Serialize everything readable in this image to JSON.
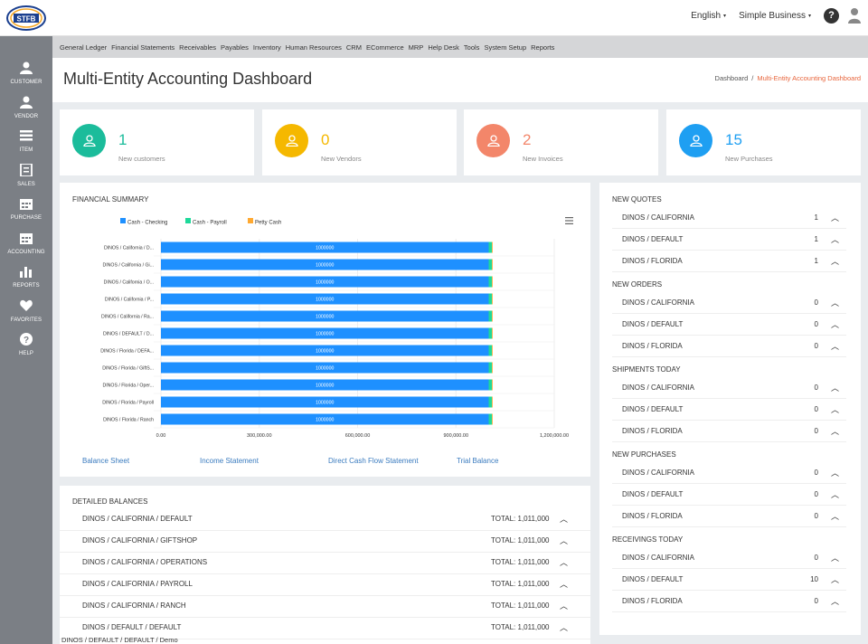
{
  "header": {
    "language": "English",
    "company": "Simple Business"
  },
  "sidebar": [
    {
      "label": "CUSTOMER",
      "icon": "person-icon"
    },
    {
      "label": "VENDOR",
      "icon": "person-icon"
    },
    {
      "label": "ITEM",
      "icon": "list-icon"
    },
    {
      "label": "SALES",
      "icon": "document-icon"
    },
    {
      "label": "PURCHASE",
      "icon": "calendar-icon"
    },
    {
      "label": "ACCOUNTING",
      "icon": "calendar-icon"
    },
    {
      "label": "REPORTS",
      "icon": "bar-chart-icon"
    },
    {
      "label": "FAVORITES",
      "icon": "heart-icon"
    },
    {
      "label": "HELP",
      "icon": "question-icon"
    }
  ],
  "menu": [
    "General Ledger",
    "Financial Statements",
    "Receivables",
    "Payables",
    "Inventory",
    "Human Resources",
    "CRM",
    "ECommerce",
    "MRP",
    "Help Desk",
    "Tools",
    "System Setup",
    "Reports"
  ],
  "page": {
    "title": "Multi-Entity Accounting Dashboard",
    "breadcrumb_home": "Dashboard",
    "breadcrumb_sep": "/",
    "breadcrumb_current": "Multi-Entity Accounting Dashboard"
  },
  "stats": [
    {
      "value": "1",
      "label": "New customers",
      "color": "#1bbc9b"
    },
    {
      "value": "0",
      "label": "New Vendors",
      "color": "#f5b800"
    },
    {
      "value": "2",
      "label": "New Invoices",
      "color": "#f3866a"
    },
    {
      "value": "15",
      "label": "New Purchases",
      "color": "#1e9ff2"
    }
  ],
  "financial_summary": {
    "title": "FINANCIAL SUMMARY",
    "links": [
      "Balance Sheet",
      "Income Statement",
      "Direct Cash Flow Statement",
      "Trial Balance"
    ]
  },
  "chart_data": {
    "type": "bar",
    "orientation": "horizontal",
    "stacked": true,
    "categories": [
      "DINOS / California / D...",
      "DINOS / California / Gi...",
      "DINOS / California / O...",
      "DINOS / California / P...",
      "DINOS / California / Ra...",
      "DINOS / DEFAULT / D...",
      "DINOS / Florida / DEFA...",
      "DINOS / Florida / GiftS...",
      "DINOS / Florida / Oper...",
      "DINOS / Florida / Payroll",
      "DINOS / Florida / Ranch"
    ],
    "series": [
      {
        "name": "Cash - Checking",
        "color": "#1e90ff",
        "values": [
          1000000,
          1000000,
          1000000,
          1000000,
          1000000,
          1000000,
          1000000,
          1000000,
          1000000,
          1000000,
          1000000
        ]
      },
      {
        "name": "Cash - Payroll",
        "color": "#1ed99a",
        "values": [
          10000,
          10000,
          10000,
          10000,
          10000,
          10000,
          10000,
          10000,
          10000,
          10000,
          10000
        ]
      },
      {
        "name": "Petty Cash",
        "color": "#ffa931",
        "values": [
          1000,
          1000,
          1000,
          1000,
          1000,
          1000,
          1000,
          1000,
          1000,
          1000,
          1000
        ]
      }
    ],
    "data_label": "1000000",
    "xlim": [
      0,
      1200000
    ],
    "xticks": [
      "0.00",
      "300,000.00",
      "600,000.00",
      "900,000.00",
      "1,200,000.00"
    ],
    "legend": "top"
  },
  "detailed_balances": {
    "title": "DETAILED BALANCES",
    "rows": [
      {
        "name": "DINOS / CALIFORNIA / DEFAULT",
        "total": "TOTAL: 1,011,000"
      },
      {
        "name": "DINOS / CALIFORNIA / GIFTSHOP",
        "total": "TOTAL: 1,011,000"
      },
      {
        "name": "DINOS / CALIFORNIA / OPERATIONS",
        "total": "TOTAL: 1,011,000"
      },
      {
        "name": "DINOS / CALIFORNIA / PAYROLL",
        "total": "TOTAL: 1,011,000"
      },
      {
        "name": "DINOS / CALIFORNIA / RANCH",
        "total": "TOTAL: 1,011,000"
      },
      {
        "name": "DINOS / DEFAULT / DEFAULT",
        "total": "TOTAL: 1,011,000"
      }
    ],
    "tail": "DINOS / DEFAULT / DEFAULT / Demo"
  },
  "right_panel": [
    {
      "title": "NEW QUOTES",
      "rows": [
        [
          "DINOS / CALIFORNIA",
          "1"
        ],
        [
          "DINOS / DEFAULT",
          "1"
        ],
        [
          "DINOS / FLORIDA",
          "1"
        ]
      ]
    },
    {
      "title": "NEW ORDERS",
      "rows": [
        [
          "DINOS / CALIFORNIA",
          "0"
        ],
        [
          "DINOS / DEFAULT",
          "0"
        ],
        [
          "DINOS / FLORIDA",
          "0"
        ]
      ]
    },
    {
      "title": "SHIPMENTS TODAY",
      "rows": [
        [
          "DINOS / CALIFORNIA",
          "0"
        ],
        [
          "DINOS / DEFAULT",
          "0"
        ],
        [
          "DINOS / FLORIDA",
          "0"
        ]
      ]
    },
    {
      "title": "NEW PURCHASES",
      "rows": [
        [
          "DINOS / CALIFORNIA",
          "0"
        ],
        [
          "DINOS / DEFAULT",
          "0"
        ],
        [
          "DINOS / FLORIDA",
          "0"
        ]
      ]
    },
    {
      "title": "RECEIVINGS TODAY",
      "rows": [
        [
          "DINOS / CALIFORNIA",
          "0"
        ],
        [
          "DINOS / DEFAULT",
          "10"
        ],
        [
          "DINOS / FLORIDA",
          "0"
        ]
      ]
    }
  ]
}
